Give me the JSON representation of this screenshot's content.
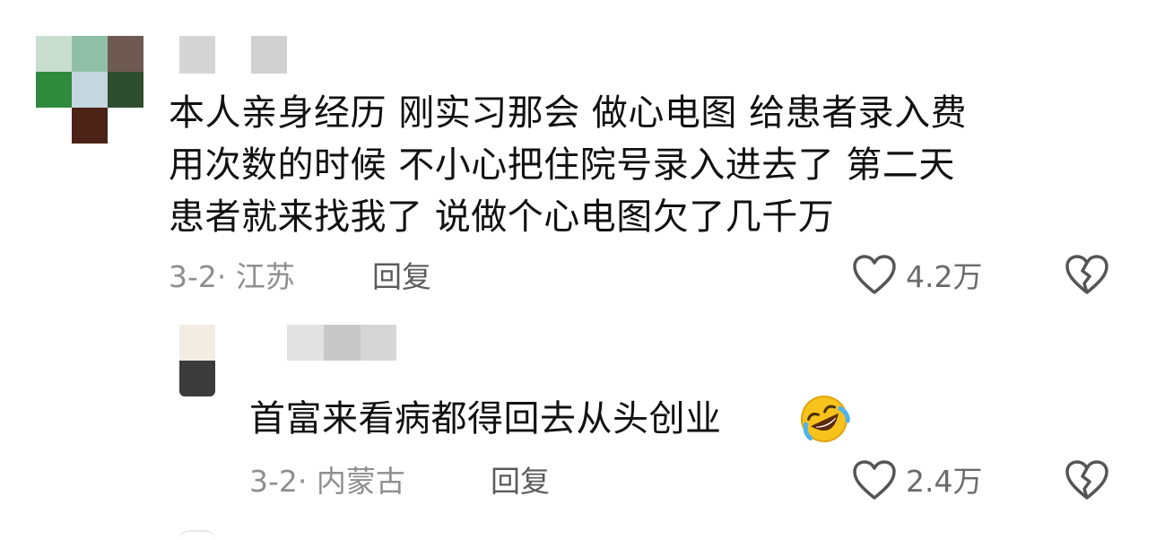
{
  "comments": [
    {
      "author": "",
      "text_lines": [
        "本人亲身经历 刚实习那会 做心电图 给患者录入费",
        "用次数的时候 不小心把住院号录入进去了 第二天",
        "患者就来找我了 说做个心电图欠了几千万"
      ],
      "date": "3-2",
      "location": "江苏",
      "reply_label": "回复",
      "like_count": "4.2万",
      "avatar_colors": [
        "#c9ddd0",
        "#8fbfa7",
        "#6e5a52",
        "#2e8b3e",
        "#c4d6df",
        "#2f4d2f",
        "#ffffff",
        "#4a2316",
        "#ffffff"
      ],
      "replies": [
        {
          "author": "",
          "text": "首富来看病都得回去从头创业",
          "emoji": "rolling-on-floor-laughing-emoji",
          "date": "3-2",
          "location": "内蒙古",
          "reply_label": "回复",
          "like_count": "2.4万",
          "avatar_colors": [
            "#f2ece2",
            "#3b3b3b"
          ]
        }
      ]
    }
  ],
  "meta_separator": "·",
  "icons": {
    "like": "heart-outline-icon",
    "dislike": "broken-heart-icon"
  },
  "colors": {
    "text": "#111111",
    "meta": "#8f8f8f",
    "icon": "#555555"
  }
}
